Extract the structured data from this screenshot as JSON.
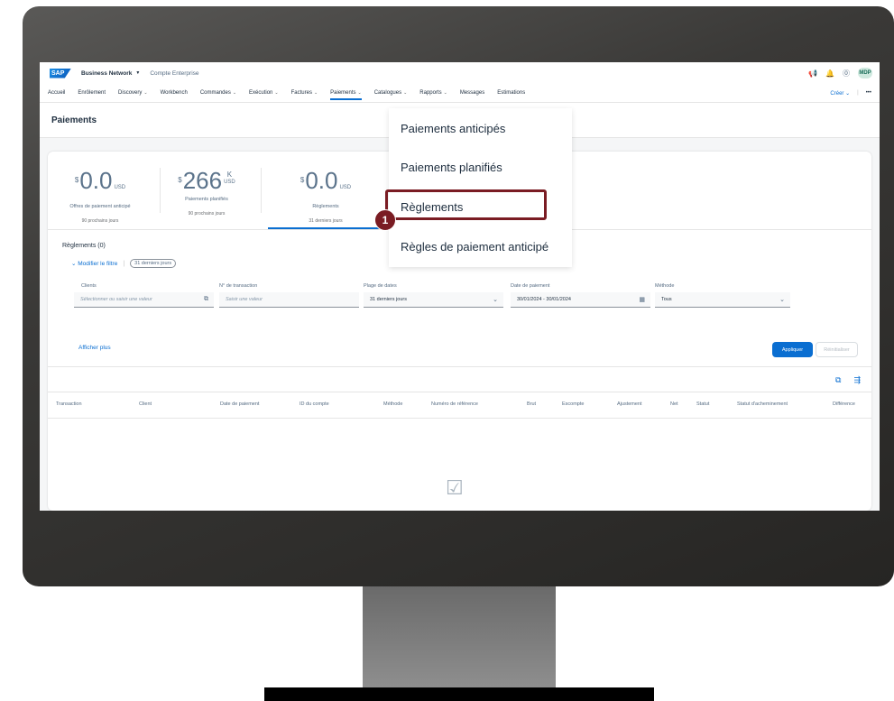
{
  "shell": {
    "logo": "SAP",
    "product": "Business Network",
    "product_chevron": "▼",
    "account": "Compte Enterprise",
    "avatar": "MDP",
    "icons": [
      "megaphone-icon",
      "bell-icon",
      "help-icon"
    ]
  },
  "nav": {
    "items": [
      {
        "label": "Accueil",
        "chevron": ""
      },
      {
        "label": "Enrôlement",
        "chevron": ""
      },
      {
        "label": "Discovery",
        "chevron": "⌄"
      },
      {
        "label": "Workbench",
        "chevron": ""
      },
      {
        "label": "Commandes",
        "chevron": "⌄"
      },
      {
        "label": "Exécution",
        "chevron": "⌄"
      },
      {
        "label": "Factures",
        "chevron": "⌄"
      },
      {
        "label": "Paiements",
        "chevron": "⌄"
      },
      {
        "label": "Catalogues",
        "chevron": "⌄"
      },
      {
        "label": "Rapports",
        "chevron": "⌄"
      },
      {
        "label": "Messages",
        "chevron": ""
      },
      {
        "label": "Estimations",
        "chevron": ""
      }
    ],
    "create_label": "Créer ⌄",
    "separator": "|",
    "more_label": "•••"
  },
  "page": {
    "title": "Paiements"
  },
  "tiles": [
    {
      "currency": "$",
      "value": "0.0",
      "unit": "USD",
      "label": "Offres de paiement anticipé",
      "sub": "90 prochains jours"
    },
    {
      "currency": "$",
      "value": "266",
      "unit_top": "K",
      "unit": "USD",
      "label": "Paiements planifiés",
      "sub": "90 prochains jours"
    },
    {
      "currency": "$",
      "value": "0.0",
      "unit": "USD",
      "label": "Règlements",
      "sub": "31 derniers jours"
    }
  ],
  "list": {
    "title": "Règlements (0)",
    "modify_filter": "⌄ Modifier le filtre",
    "pipe": "|",
    "chip": "31 derniers jours"
  },
  "filters": {
    "clients": {
      "label": "Clients",
      "placeholder": "Sélectionner ou saisir une valeur",
      "icon": "⧉"
    },
    "transaction": {
      "label": "N° de transaction",
      "placeholder": "Saisir une valeur"
    },
    "date_range": {
      "label": "Plage de dates",
      "value": "31 derniers jours",
      "icon": "⌄"
    },
    "payment_date": {
      "label": "Date de paiement",
      "value": "30/01/2024 - 30/01/2024",
      "icon": "▦"
    },
    "method": {
      "label": "Méthode",
      "value": "Tous",
      "icon": "⌄"
    }
  },
  "actions": {
    "show_more": "Afficher plus",
    "apply": "Appliquer",
    "reset": "Réinitialiser"
  },
  "table": {
    "tools": [
      "⧉",
      "⇶"
    ],
    "columns": [
      "Transaction",
      "Client",
      "Date de paiement",
      "ID du compte",
      "Méthode",
      "Numéro de référence",
      "Brut",
      "Escompte",
      "Ajustement",
      "Net",
      "Statut",
      "Statut d'acheminement",
      "Différence"
    ],
    "empty_icon": "☑"
  },
  "dropdown": {
    "items": [
      "Paiements anticipés",
      "Paiements planifiés",
      "Règlements",
      "Règles de paiement anticipé"
    ],
    "highlighted_index": 2
  },
  "step": {
    "number": "1"
  },
  "colors": {
    "accent": "#0a6ed1",
    "highlight": "#7a1c23",
    "monitor": "#3a3937"
  }
}
